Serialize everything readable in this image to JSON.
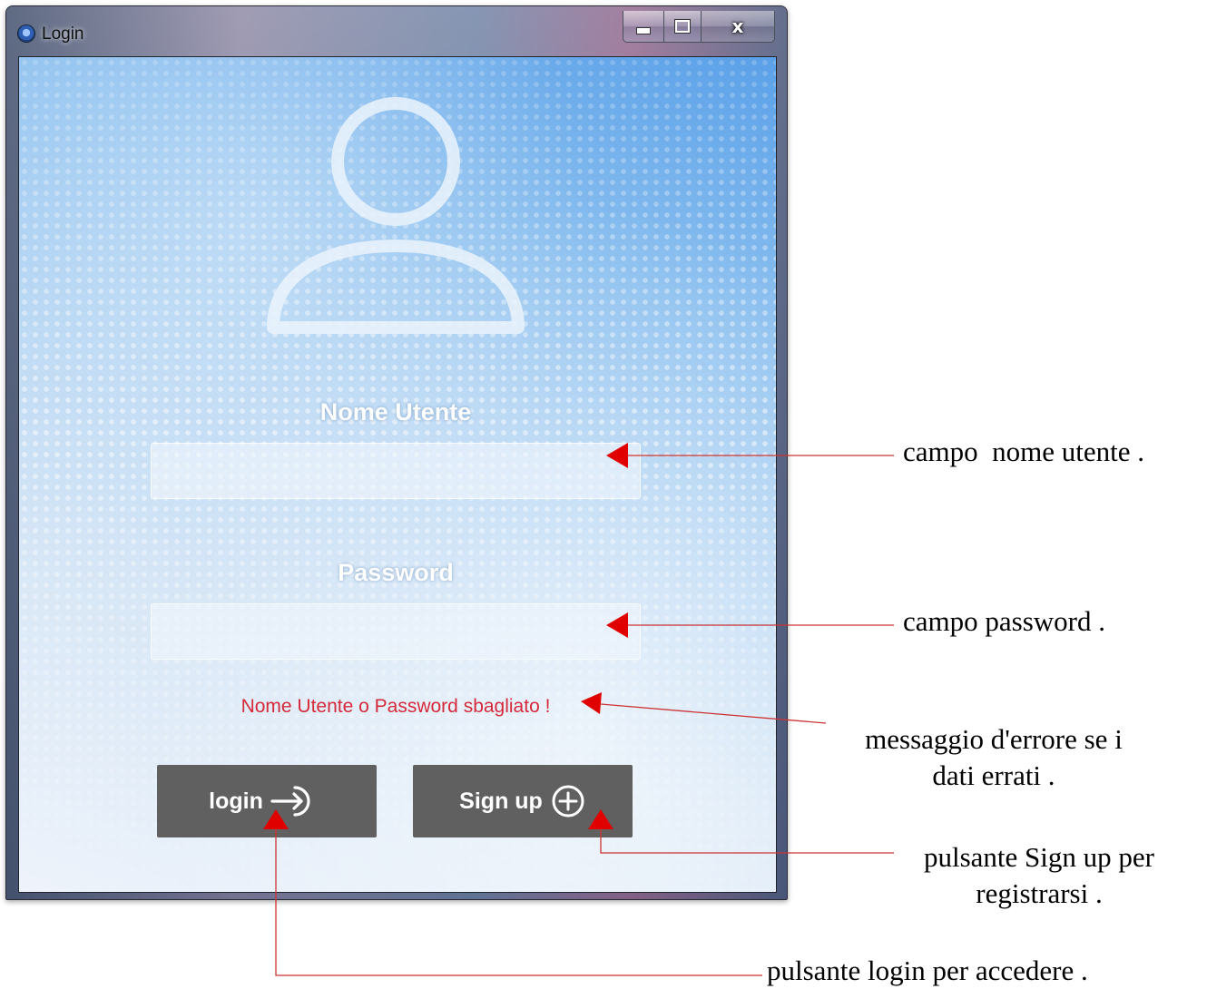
{
  "window": {
    "title": "Login",
    "caption_buttons": {
      "minimize": "minimize",
      "maximize": "maximize",
      "close": "x"
    }
  },
  "form": {
    "username_label": "Nome Utente",
    "username_value": "",
    "password_label": "Password",
    "password_value": "",
    "error_message": "Nome Utente o Password sbagliato !",
    "login_label": "login",
    "signup_label": "Sign up"
  },
  "annotations": {
    "username": "campo  nome utente .",
    "password": "campo password .",
    "error_line1": "messaggio d'errore se i",
    "error_line2": "dati errati .",
    "signup_line1": "pulsante Sign up per",
    "signup_line2": "registrarsi .",
    "login": "pulsante login per accedere ."
  },
  "icons": {
    "app": "app-logo-icon",
    "avatar": "user-avatar-icon",
    "login": "arrow-into-circle-icon",
    "signup": "plus-circle-icon"
  },
  "colors": {
    "button_bg": "#606060",
    "error_text": "#d42a3a",
    "annotation_arrow": "#e00000",
    "annotation_line": "#cc3333"
  }
}
